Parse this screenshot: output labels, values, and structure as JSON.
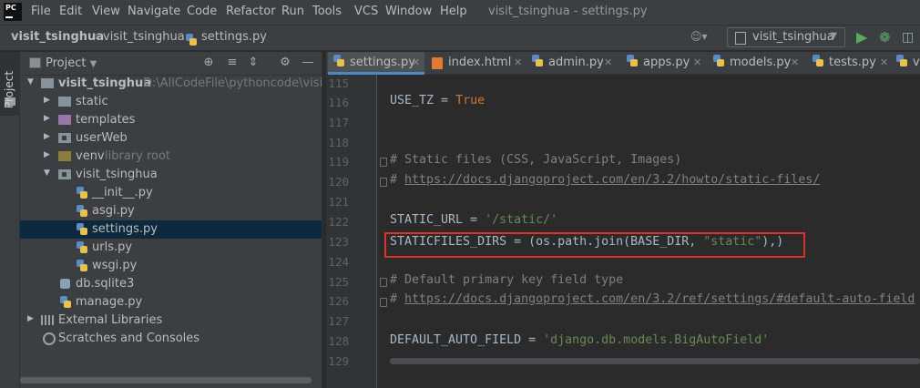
{
  "app": {
    "logo_text": "PC",
    "window_title": "visit_tsinghua - settings.py"
  },
  "menu": [
    "File",
    "Edit",
    "View",
    "Navigate",
    "Code",
    "Refactor",
    "Run",
    "Tools",
    "VCS",
    "Window",
    "Help"
  ],
  "breadcrumb": {
    "project": "visit_tsinghua",
    "package": "visit_tsinghua",
    "file": "settings.py"
  },
  "run_config": {
    "label": "visit_tsinghua"
  },
  "project_panel": {
    "title": "Project",
    "root_name": "visit_tsinghua",
    "root_path": "D:\\AllCodeFile\\pythoncode\\visit_ts",
    "items": [
      {
        "label": "static"
      },
      {
        "label": "templates"
      },
      {
        "label": "userWeb"
      },
      {
        "label": "venv",
        "hint": "library root"
      },
      {
        "label": "visit_tsinghua"
      },
      {
        "label": "__init__.py"
      },
      {
        "label": "asgi.py"
      },
      {
        "label": "settings.py"
      },
      {
        "label": "urls.py"
      },
      {
        "label": "wsgi.py"
      },
      {
        "label": "db.sqlite3"
      },
      {
        "label": "manage.py"
      },
      {
        "label": "External Libraries"
      },
      {
        "label": "Scratches and Consoles"
      }
    ]
  },
  "tool_strip": {
    "project_tab": "Project"
  },
  "tabs": [
    "settings.py",
    "index.html",
    "admin.py",
    "apps.py",
    "models.py",
    "tests.py",
    "v"
  ],
  "line_numbers": [
    "115",
    "116",
    "117",
    "118",
    "119",
    "120",
    "121",
    "122",
    "123",
    "124",
    "125",
    "126",
    "127",
    "128",
    "129"
  ],
  "code": {
    "l115_a": "USE_TZ = ",
    "l115_b": "True",
    "l119": "# Static files (CSS, JavaScript, Images)",
    "l120_a": "# ",
    "l120_b": "https://docs.djangoproject.com/en/3.2/howto/static-files/",
    "l122_a": "STATIC_URL = ",
    "l122_b": "'/static/'",
    "l123_a": "STATICFILES_DIRS = (os.path.join(BASE_DIR, ",
    "l123_b": "\"static\"",
    "l123_c": "),",
    "l123_d": ")",
    "l125": "# Default primary key field type",
    "l126_a": "# ",
    "l126_b": "https://docs.djangoproject.com/en/3.2/ref/settings/#default-auto-field",
    "l128_a": "DEFAULT_AUTO_FIELD = ",
    "l128_b": "'django.db.models.BigAutoField'"
  },
  "colors": {
    "highlight_box": "#e0302a",
    "selection": "#0d293e",
    "keyword": "#cc7832",
    "string": "#6a8759"
  },
  "icons": [
    "project-logo",
    "user-icon",
    "run-icon",
    "debug-icon",
    "coverage-icon",
    "locate-icon",
    "collapse-icon",
    "expand-icon",
    "gear-icon",
    "hide-icon"
  ]
}
